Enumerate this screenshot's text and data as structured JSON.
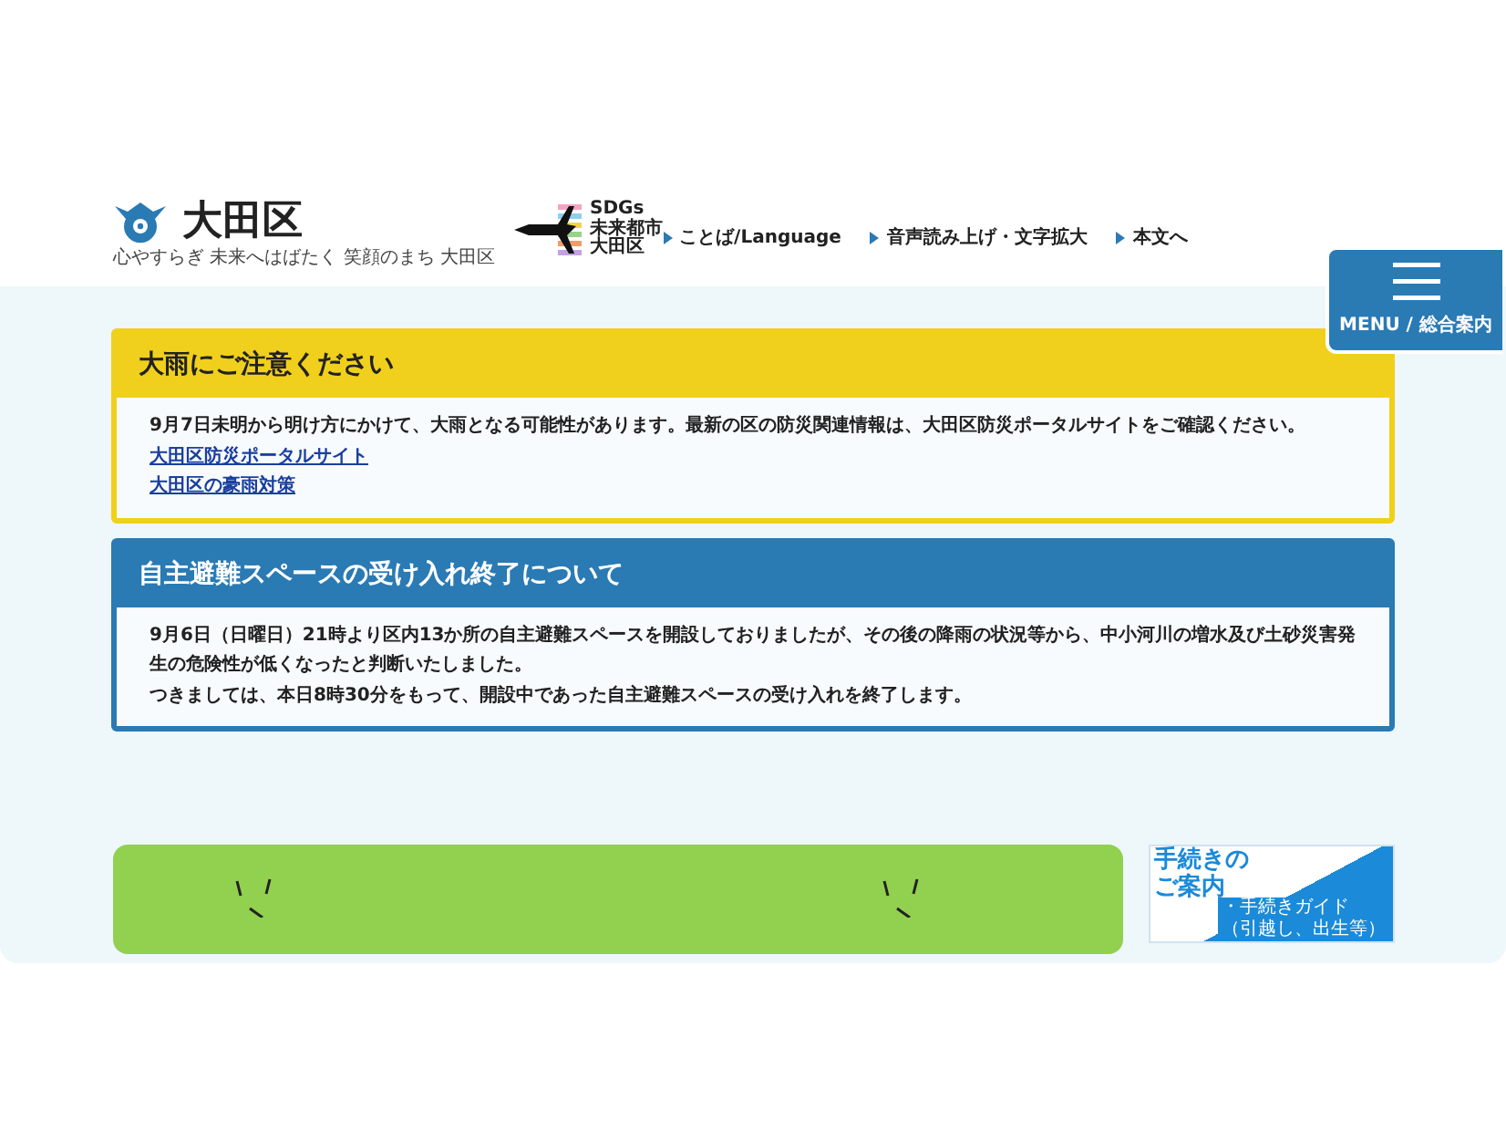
{
  "header": {
    "logo": {
      "name": "大田区",
      "tagline": "心やすらぎ 未来へはばたく 笑顔のまち 大田区"
    },
    "sdgs_logo": {
      "lines": [
        "SDGs",
        "未来都市",
        "大田区"
      ]
    },
    "links": [
      "ことば/Language",
      "音声読み上げ・文字拡大",
      "本文へ"
    ]
  },
  "menu_button": {
    "label": "MENU / 総合案内"
  },
  "notices": [
    {
      "kind": "warning",
      "title": "大雨にご注意ください",
      "paragraphs": [
        "9月7日未明から明け方にかけて、大雨となる可能性があります。最新の区の防災関連情報は、大田区防災ポータルサイトをご確認ください。"
      ],
      "links": [
        "大田区防災ポータルサイト",
        "大田区の豪雨対策"
      ]
    },
    {
      "kind": "info",
      "title": "自主避難スペースの受け入れ終了について",
      "paragraphs": [
        "9月6日（日曜日）21時より区内13か所の自主避難スペースを開設しておりましたが、その後の降雨の状況等から、中小河川の増水及び土砂災害発生の危険性が低くなったと判断いたしました。",
        "つきましては、本日8時30分をもって、開設中であった自主避難スペースの受け入れを終了します。"
      ]
    }
  ],
  "procedure_card": {
    "title_lines": [
      "手続きの",
      "ご案内"
    ],
    "items": [
      "・手続きガイド",
      "（引越し、出生等）"
    ]
  }
}
